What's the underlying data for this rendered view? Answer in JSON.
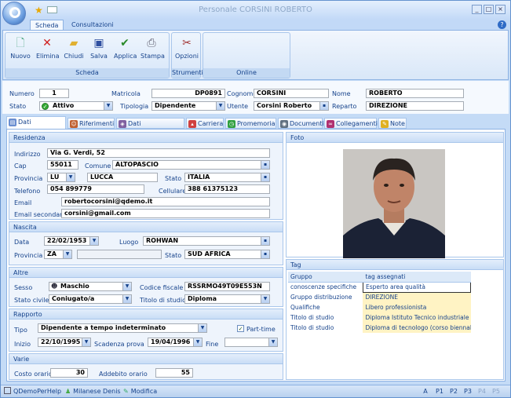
{
  "window": {
    "title": "Personale CORSINI ROBERTO"
  },
  "ribbon": {
    "tabs": [
      "Scheda",
      "Consultazioni"
    ],
    "groups": [
      {
        "label": "Scheda",
        "buttons": [
          "Nuovo",
          "Elimina",
          "Chiudi",
          "Salva",
          "Applica",
          "Stampa"
        ]
      },
      {
        "label": "Strumenti",
        "buttons": [
          "Opzioni"
        ]
      },
      {
        "label": "Online",
        "buttons": []
      }
    ]
  },
  "header": {
    "numero_label": "Numero",
    "numero": "1",
    "matricola_label": "Matricola",
    "matricola": "DP0891",
    "cognome_label": "Cognome",
    "cognome": "CORSINI",
    "nome_label": "Nome",
    "nome": "ROBERTO",
    "stato_label": "Stato",
    "stato": "Attivo",
    "tipologia_label": "Tipologia",
    "tipologia": "Dipendente",
    "utente_label": "Utente",
    "utente": "Corsini Roberto",
    "reparto_label": "Reparto",
    "reparto": "DIREZIONE"
  },
  "tabs": [
    "Dati Anagrafici",
    "Riferimenti",
    "Dati Personalizzati",
    "Carriera",
    "Promemoria",
    "Documenti",
    "Collegamenti",
    "Note"
  ],
  "residenza": {
    "title": "Residenza",
    "indirizzo_label": "Indirizzo",
    "indirizzo": "Via G. Verdi, 52",
    "cap_label": "Cap",
    "cap": "55011",
    "comune_label": "Comune",
    "comune": "ALTOPASCIO",
    "provincia_label": "Provincia",
    "provincia": "LU",
    "provincia_nome": "LUCCA",
    "stato_label": "Stato",
    "stato": "ITALIA",
    "telefono_label": "Telefono",
    "telefono": "054 899779",
    "cellulare_label": "Cellulare",
    "cellulare": "388 61375123",
    "email_label": "Email",
    "email": "robertocorsini@qdemo.it",
    "email2_label": "Email secondaria",
    "email2": "corsini@gmail.com"
  },
  "nascita": {
    "title": "Nascita",
    "data_label": "Data",
    "data": "22/02/1953",
    "luogo_label": "Luogo",
    "luogo": "ROHWAN",
    "provincia_label": "Provincia",
    "provincia": "ZA",
    "stato_label": "Stato",
    "stato": "SUD AFRICA"
  },
  "altre": {
    "title": "Altre",
    "sesso_label": "Sesso",
    "sesso": "Maschio",
    "cf_label": "Codice fiscale",
    "cf": "RSSRMO49T09E553N",
    "civile_label": "Stato civile",
    "civile": "Coniugato/a",
    "titolo_label": "Titolo di studio",
    "titolo": "Diploma"
  },
  "rapporto": {
    "title": "Rapporto",
    "tipo_label": "Tipo",
    "tipo": "Dipendente a tempo indeterminato",
    "parttime_label": "Part-time",
    "inizio_label": "Inizio",
    "inizio": "22/10/1995",
    "prova_label": "Scadenza prova",
    "prova": "19/04/1996",
    "fine_label": "Fine",
    "fine": ""
  },
  "varie": {
    "title": "Varie",
    "costo_label": "Costo orario",
    "costo": "30",
    "addebito_label": "Addebito orario",
    "addebito": "55"
  },
  "foto": {
    "title": "Foto"
  },
  "tag": {
    "title": "Tag",
    "col_gruppo": "Gruppo",
    "col_tag": "tag assegnati",
    "rows": [
      {
        "gruppo": "conoscenze specifiche",
        "tag": "Esperto area qualità"
      },
      {
        "gruppo": "Gruppo distribuzione",
        "tag": "DIREZIONE"
      },
      {
        "gruppo": "Qualifiche",
        "tag": "Libero professionista"
      },
      {
        "gruppo": "Titolo di studio",
        "tag": "Diploma Istituto Tecnico industriale"
      },
      {
        "gruppo": "Titolo di studio",
        "tag": "Diploma di tecnologo (corso biennale p"
      }
    ]
  },
  "statusbar": {
    "items": [
      "QDemoPerHelp",
      "Milanese Denis",
      "Modifica"
    ],
    "pages": [
      "A",
      "P1",
      "P2",
      "P3",
      "P4",
      "P5"
    ]
  }
}
